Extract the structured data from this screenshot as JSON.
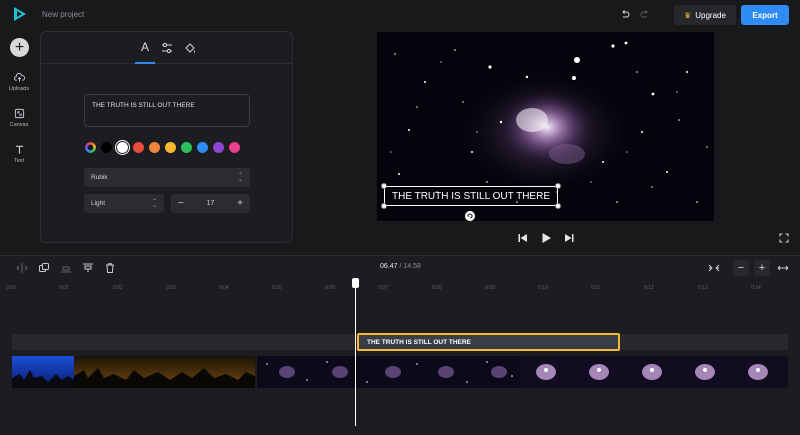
{
  "topbar": {
    "project_name": "New project",
    "upgrade_label": "Upgrade",
    "export_label": "Export",
    "accent": "#2f8bf5"
  },
  "leftbar": {
    "add_icon": "plus-icon",
    "items": [
      {
        "label": "Uploads",
        "icon": "upload-cloud-icon"
      },
      {
        "label": "Canvas",
        "icon": "canvas-resize-icon"
      },
      {
        "label": "Text",
        "icon": "text-t-icon"
      }
    ]
  },
  "panel": {
    "tabs": [
      {
        "name": "text-style",
        "icon": "letter-a-icon",
        "glyph": "A",
        "active": true
      },
      {
        "name": "adjust",
        "icon": "sliders-icon",
        "active": false
      },
      {
        "name": "fill",
        "icon": "paint-bucket-icon",
        "active": false
      }
    ],
    "text_value": "THE TRUTH IS STILL OUT THERE",
    "colors": [
      "#000000",
      "#ffffff",
      "#e74c3c",
      "#f0843c",
      "#f5b82e",
      "#2ec05a",
      "#2f8bf5",
      "#8e44d4",
      "#e83e8c"
    ],
    "selected_color": "#ffffff",
    "font_family": "Rubik",
    "font_weight": "Light",
    "font_size": "17"
  },
  "preview": {
    "caption": "THE TRUTH IS STILL OUT THERE"
  },
  "timeline": {
    "current_time": "06.47",
    "separator": "/",
    "total_time": "14.58",
    "ticks": [
      "0:00",
      "0:01",
      "0:02",
      "0:03",
      "0:04",
      "0:05",
      "0:06",
      "0:07",
      "0:08",
      "0:09",
      "0:10",
      "0:11",
      "0:12",
      "0:13",
      "0:14"
    ],
    "text_clip_label": "THE TRUTH IS STILL OUT THERE"
  }
}
